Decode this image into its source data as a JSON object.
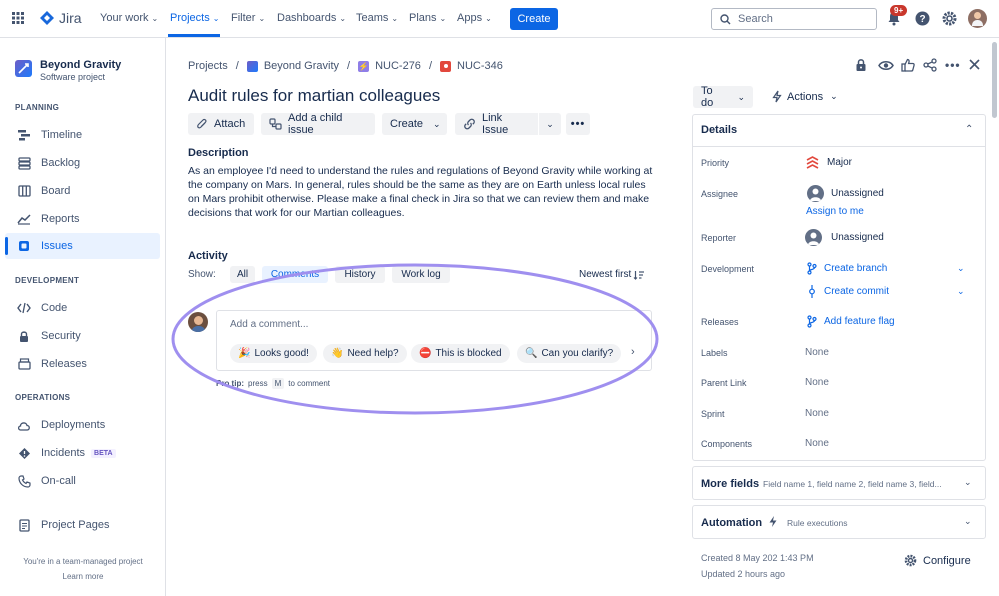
{
  "topnav": {
    "brand": "Jira",
    "items": [
      {
        "label": "Your work"
      },
      {
        "label": "Projects"
      },
      {
        "label": "Filter"
      },
      {
        "label": "Dashboards"
      },
      {
        "label": "Teams"
      },
      {
        "label": "Plans"
      },
      {
        "label": "Apps"
      }
    ],
    "create_label": "Create",
    "search_placeholder": "Search",
    "notification_count": "9+"
  },
  "sidebar": {
    "project_name": "Beyond Gravity",
    "project_type": "Software project",
    "planning_heading": "PLANNING",
    "planning_items": [
      {
        "label": "Timeline"
      },
      {
        "label": "Backlog"
      },
      {
        "label": "Board"
      },
      {
        "label": "Reports"
      },
      {
        "label": "Issues"
      }
    ],
    "development_heading": "DEVELOPMENT",
    "development_items": [
      {
        "label": "Code"
      },
      {
        "label": "Security"
      },
      {
        "label": "Releases"
      }
    ],
    "operations_heading": "OPERATIONS",
    "operations_items": [
      {
        "label": "Deployments"
      },
      {
        "label": "Incidents",
        "badge": "BETA"
      },
      {
        "label": "On-call"
      }
    ],
    "project_pages": "Project Pages",
    "footer_text": "You're in a team-managed project",
    "footer_link": "Learn more"
  },
  "breadcrumb": {
    "projects": "Projects",
    "project": "Beyond Gravity",
    "epic": "NUC-276",
    "issue": "NUC-346"
  },
  "issue": {
    "title": "Audit rules for martian colleagues",
    "toolbar": {
      "attach": "Attach",
      "add_child": "Add a child issue",
      "create": "Create",
      "link_issue": "Link Issue"
    },
    "description_heading": "Description",
    "description": "As an employee I'd need to understand the rules and regulations of Beyond Gravity while working at the company on Mars. In general, rules should be the same as they are on Earth unless local rules on Mars prohibit otherwise. Please make a final check in Jira so that we can review them and make decisions that work for our Martian colleagues."
  },
  "activity": {
    "heading": "Activity",
    "show_label": "Show:",
    "filters": [
      {
        "label": "All"
      },
      {
        "label": "Comments"
      },
      {
        "label": "History"
      },
      {
        "label": "Work log"
      }
    ],
    "sort": "Newest first",
    "comment_placeholder": "Add a comment...",
    "quick_replies": [
      {
        "emoji": "🎉",
        "label": "Looks good!"
      },
      {
        "emoji": "👋",
        "label": "Need help?"
      },
      {
        "emoji": "⛔",
        "label": "This is blocked"
      },
      {
        "emoji": "🔍",
        "label": "Can you clarify?"
      }
    ],
    "protip_prefix": "Pro tip:",
    "protip_press": "press",
    "protip_key": "M",
    "protip_suffix": "to comment"
  },
  "right": {
    "status": "To do",
    "actions": "Actions",
    "details_heading": "Details",
    "priority_label": "Priority",
    "priority_value": "Major",
    "assignee_label": "Assignee",
    "assignee_value": "Unassigned",
    "assign_to_me": "Assign to me",
    "reporter_label": "Reporter",
    "reporter_value": "Unassigned",
    "development_label": "Development",
    "create_branch": "Create branch",
    "create_commit": "Create commit",
    "releases_label": "Releases",
    "add_feature_flag": "Add feature flag",
    "labels_label": "Labels",
    "labels_value": "None",
    "parent_label": "Parent Link",
    "parent_value": "None",
    "sprint_label": "Sprint",
    "sprint_value": "None",
    "components_label": "Components",
    "components_value": "None",
    "more_fields": "More fields",
    "more_fields_hint": "Field name 1, field name 2, field name 3, field...",
    "automation": "Automation",
    "rule_executions": "Rule executions",
    "created": "Created 8 May 202 1:43 PM",
    "updated": "Updated 2 hours ago",
    "configure": "Configure"
  },
  "colors": {
    "accent": "#0c66e4",
    "highlight_ellipse": "#9f8fef",
    "priority": "#e2483d"
  }
}
